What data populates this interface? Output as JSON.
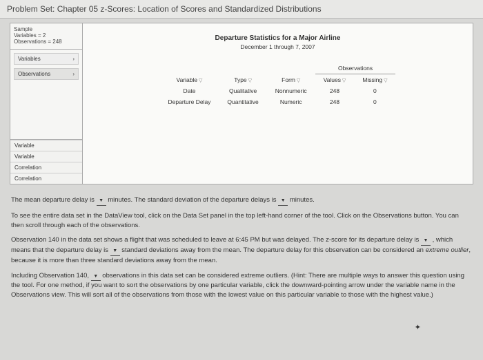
{
  "header": {
    "title": "Problem Set: Chapter 05 z-Scores: Location of Scores and Standardized Distributions"
  },
  "tool": {
    "top_panel": {
      "line1": "Sample",
      "line2": "Variables = 2",
      "line3": "Observations = 248"
    },
    "nav": {
      "variables": "Variables",
      "observations": "Observations"
    },
    "bottom_nav": {
      "a": "Variable",
      "b": "Variable",
      "c": "Correlation",
      "d": "Correlation"
    },
    "main": {
      "title": "Departure Statistics for a Major Airline",
      "subtitle": "December 1 through 7, 2007",
      "table": {
        "group_header": "Observations",
        "cols": {
          "variable": "Variable",
          "type": "Type",
          "form": "Form",
          "values": "Values",
          "missing": "Missing"
        },
        "rows": [
          {
            "variable": "Date",
            "type": "Qualitative",
            "form": "Nonnumeric",
            "values": "248",
            "missing": "0"
          },
          {
            "variable": "Departure Delay",
            "type": "Quantitative",
            "form": "Numeric",
            "values": "248",
            "missing": "0"
          }
        ]
      }
    }
  },
  "text": {
    "p1a": "The mean departure delay is ",
    "p1b": " minutes. The standard deviation of the departure delays is ",
    "p1c": " minutes.",
    "p2": "To see the entire data set in the DataView tool, click on the Data Set panel in the top left-hand corner of the tool. Click on the Observations button. You can then scroll through each of the observations.",
    "p3a": "Observation 140 in the data set shows a flight that was scheduled to leave at 6:45 PM but was delayed. The z-score for its departure delay is ",
    "p3b": " , which means that the departure delay is ",
    "p3c": " standard deviations away from the mean. The departure delay for this observation can be considered an ",
    "p3c_em": "extreme outlier",
    "p3d": ", because it is more than three standard deviations away from the mean.",
    "p4a": "Including Observation 140, ",
    "p4b": " observations in this data set can be considered extreme outliers. (Hint: There are multiple ways to answer this question using the tool. For one method, if you want to sort the observations by one particular variable, click the downward-pointing arrow under the variable name in the Observations view. This will sort all of the observations from those with the lowest value on this particular variable to those with the highest value.)"
  }
}
